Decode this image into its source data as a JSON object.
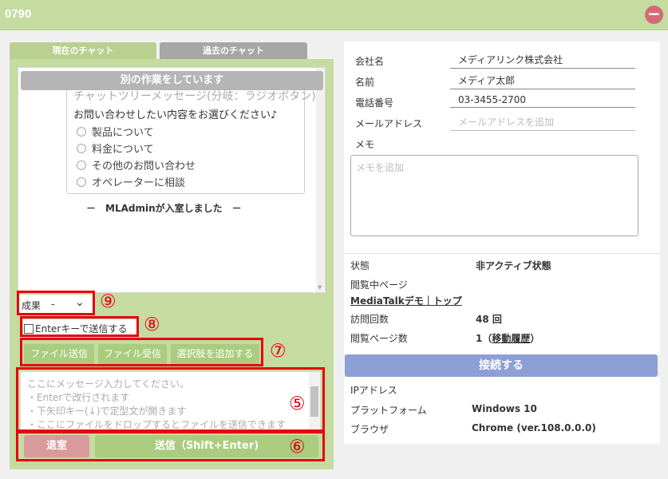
{
  "header": {
    "title": "0790",
    "collapse_icon": "−"
  },
  "tabs": {
    "current": "現在のチャット",
    "past": "過去のチャット"
  },
  "chat": {
    "busy_banner": "別の作業をしています",
    "card_title": "チャットツリーメッセージ(分岐：ラジオボタン)",
    "question": "お問い合わせしたい内容をお選びください♪",
    "options": [
      "製品について",
      "料金について",
      "その他のお問い合わせ",
      "オペレーターに相談"
    ],
    "join_message": "－　MLAdminが入室しました　－"
  },
  "controls": {
    "result_label": "成果",
    "result_value": "-",
    "enter_send_label": "Enterキーで送信する",
    "file_send": "ファイル送信",
    "file_receive": "ファイル受信",
    "add_choice": "選択肢を追加する",
    "input_placeholder_lines": [
      "ここにメッセージ入力してください。",
      "・Enterで改行されます",
      "・下矢印キー(↓)で定型文が開きます",
      "・ここにファイルをドロップするとファイルを送信できます"
    ],
    "exit": "退室",
    "send": "送信（Shift+Enter)"
  },
  "annotations": {
    "n9": "⑨",
    "n8": "⑧",
    "n7": "⑦",
    "n5": "⑤",
    "n6": "⑥"
  },
  "visitor": {
    "company_label": "会社名",
    "company_value": "メディアリンク株式会社",
    "name_label": "名前",
    "name_value": "メディア太郎",
    "phone_label": "電話番号",
    "phone_value": "03-3455-2700",
    "email_label": "メールアドレス",
    "email_placeholder": "メールアドレスを追加",
    "memo_label": "メモ",
    "memo_placeholder": "メモを追加"
  },
  "status": {
    "state_label": "状態",
    "state_value": "非アクティブ状態",
    "viewing_label": "閲覧中ページ",
    "viewing_link": "MediaTalkデモ｜トップ",
    "visits_label": "訪問回数",
    "visits_value": "48 回",
    "pages_label": "閲覧ページ数",
    "pages_value": "1（",
    "pages_link": "移動履歴",
    "pages_close": "）"
  },
  "connect_button": "接続する",
  "environment": {
    "ip_label": "IPアドレス",
    "platform_label": "プラットフォーム",
    "platform_value": "Windows 10",
    "browser_label": "ブラウザ",
    "browser_value": "Chrome (ver.108.0.0.0)"
  }
}
